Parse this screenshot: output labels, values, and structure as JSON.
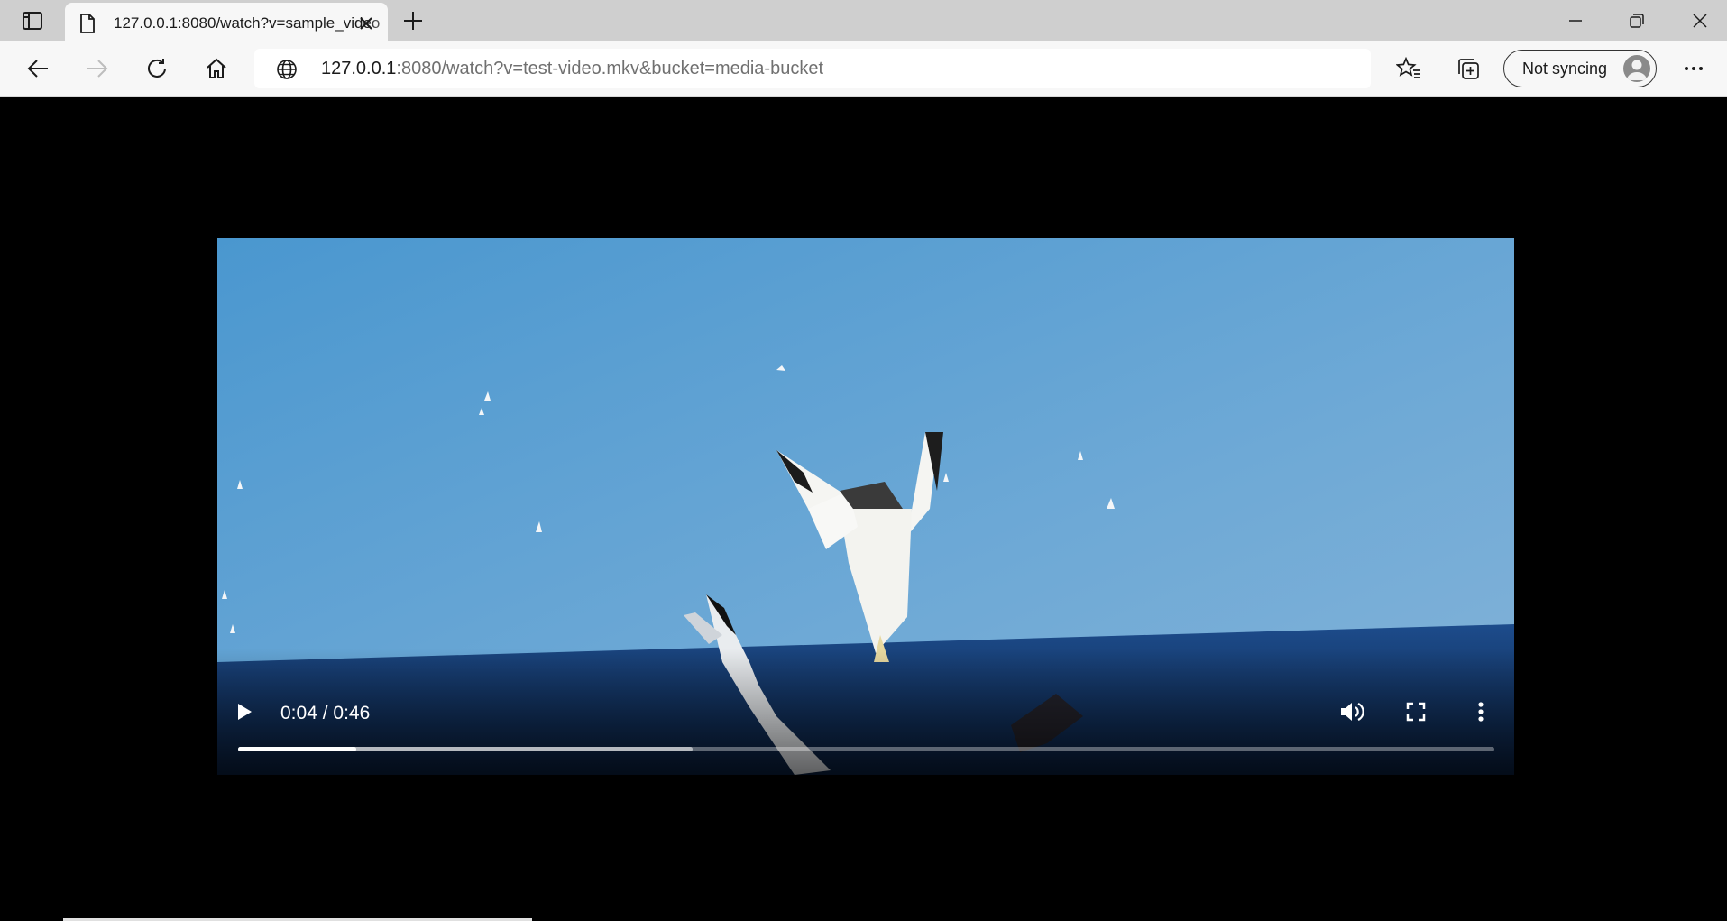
{
  "browser": {
    "tab": {
      "title": "127.0.0.1:8080/watch?v=sample_video"
    },
    "address": {
      "host": "127.0.0.1",
      "rest": ":8080/watch?v=test-video.mkv&bucket=media-bucket"
    },
    "profile": {
      "label": "Not syncing"
    },
    "icons": [
      "tab-actions-icon",
      "page-icon",
      "close-icon",
      "plus-icon",
      "minimize-icon",
      "restore-icon",
      "window-close-icon",
      "back-icon",
      "forward-icon",
      "refresh-icon",
      "home-icon",
      "globe-icon",
      "favorites-icon",
      "collections-icon",
      "avatar-icon",
      "more-icon"
    ]
  },
  "video": {
    "current_time": "0:04",
    "separator": " / ",
    "duration": "0:46",
    "played_fraction": 0.0938,
    "buffered_fraction": 0.362,
    "icons": [
      "play-icon",
      "volume-icon",
      "fullscreen-icon",
      "more-vertical-icon"
    ]
  }
}
